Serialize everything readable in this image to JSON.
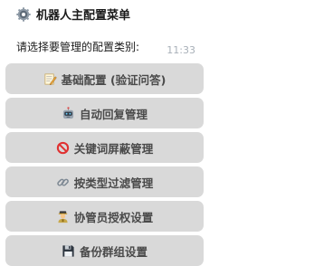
{
  "message": {
    "title": "机器人主配置菜单",
    "title_icon": "gear-icon",
    "subtitle": "请选择要管理的配置类别:",
    "time": "11:33"
  },
  "buttons": [
    {
      "label": "基础配置 (验证问答)",
      "icon": "memo-icon"
    },
    {
      "label": "自动回复管理",
      "icon": "robot-icon"
    },
    {
      "label": "关键词屏蔽管理",
      "icon": "prohibited-icon"
    },
    {
      "label": "按类型过滤管理",
      "icon": "link-icon"
    },
    {
      "label": "协管员授权设置",
      "icon": "guard-icon"
    },
    {
      "label": "备份群组设置",
      "icon": "floppy-disk-icon"
    }
  ]
}
